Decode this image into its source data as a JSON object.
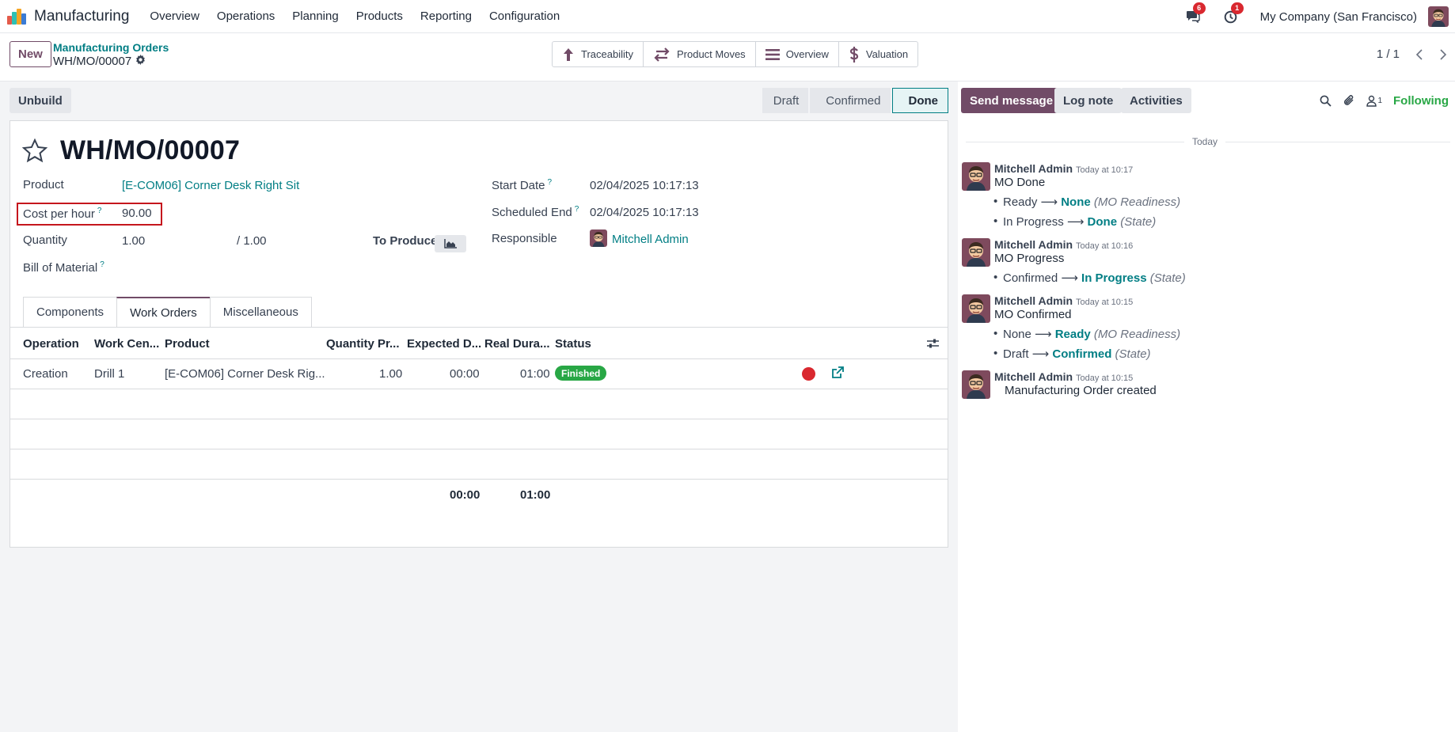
{
  "app": {
    "name": "Manufacturing"
  },
  "menu": [
    "Overview",
    "Operations",
    "Planning",
    "Products",
    "Reporting",
    "Configuration"
  ],
  "systray": {
    "messages_count": "6",
    "activities_count": "1",
    "company": "My Company (San Francisco)"
  },
  "control": {
    "new_label": "New",
    "breadcrumb": "Manufacturing Orders",
    "record": "WH/MO/00007",
    "smart_buttons": [
      "Traceability",
      "Product Moves",
      "Overview",
      "Valuation"
    ],
    "pager": "1 / 1"
  },
  "statusbar": {
    "unbuild_label": "Unbuild",
    "stages": [
      "Draft",
      "Confirmed",
      "Done"
    ],
    "active_stage": "Done"
  },
  "form": {
    "title": "WH/MO/00007",
    "product_label": "Product",
    "product_value": "[E-COM06] Corner Desk Right Sit",
    "cost_label": "Cost per hour",
    "cost_value": "90.00",
    "quantity_label": "Quantity",
    "quantity_value": "1.00",
    "quantity_total": "/ 1.00",
    "to_produce_label": "To Produce",
    "bom_label": "Bill of Material",
    "start_label": "Start Date",
    "start_value": "02/04/2025 10:17:13",
    "end_label": "Scheduled End",
    "end_value": "02/04/2025 10:17:13",
    "responsible_label": "Responsible",
    "responsible_value": "Mitchell Admin",
    "help_mark": "?"
  },
  "tabs": [
    "Components",
    "Work Orders",
    "Miscellaneous"
  ],
  "active_tab": "Work Orders",
  "workorders": {
    "columns": [
      "Operation",
      "Work Cen...",
      "Product",
      "Quantity Pr...",
      "Expected D...",
      "Real Dura...",
      "Status"
    ],
    "rows": [
      {
        "operation": "Creation",
        "work_center": "Drill 1",
        "product": "[E-COM06] Corner Desk Rig...",
        "quantity": "1.00",
        "expected": "00:00",
        "real": "01:00",
        "status": "Finished"
      }
    ],
    "totals": {
      "expected": "00:00",
      "real": "01:00"
    }
  },
  "chatter": {
    "send_message": "Send message",
    "log_note": "Log note",
    "activities": "Activities",
    "followers_count": "1",
    "following": "Following",
    "day": "Today",
    "messages": [
      {
        "author": "Mitchell Admin",
        "time": "Today at 10:17",
        "body": "MO Done",
        "changes": [
          {
            "old": "Ready",
            "new": "None",
            "field": "(MO Readiness)"
          },
          {
            "old": "In Progress",
            "new": "Done",
            "field": "(State)"
          }
        ]
      },
      {
        "author": "Mitchell Admin",
        "time": "Today at 10:16",
        "body": "MO Progress",
        "changes": [
          {
            "old": "Confirmed",
            "new": "In Progress",
            "field": "(State)"
          }
        ]
      },
      {
        "author": "Mitchell Admin",
        "time": "Today at 10:15",
        "body": "MO Confirmed",
        "changes": [
          {
            "old": "None",
            "new": "Ready",
            "field": "(MO Readiness)"
          },
          {
            "old": "Draft",
            "new": "Confirmed",
            "field": "(State)"
          }
        ]
      },
      {
        "author": "Mitchell Admin",
        "time": "Today at 10:15",
        "body": "Manufacturing Order created",
        "changes": []
      }
    ]
  },
  "colors": {
    "brand": "#714b67",
    "link": "#017e84",
    "success": "#28a745",
    "danger": "#d9282f"
  },
  "icons": [
    "manufacturing-app-icon",
    "chat-icon",
    "clock-icon",
    "settings-gear-icon",
    "arrow-up-icon",
    "swap-arrows-icon",
    "list-icon",
    "dollar-icon",
    "chevron-left-icon",
    "chevron-right-icon",
    "star-icon",
    "area-chart-icon",
    "column-settings-icon",
    "external-link-icon",
    "search-icon",
    "paperclip-icon",
    "person-icon"
  ]
}
